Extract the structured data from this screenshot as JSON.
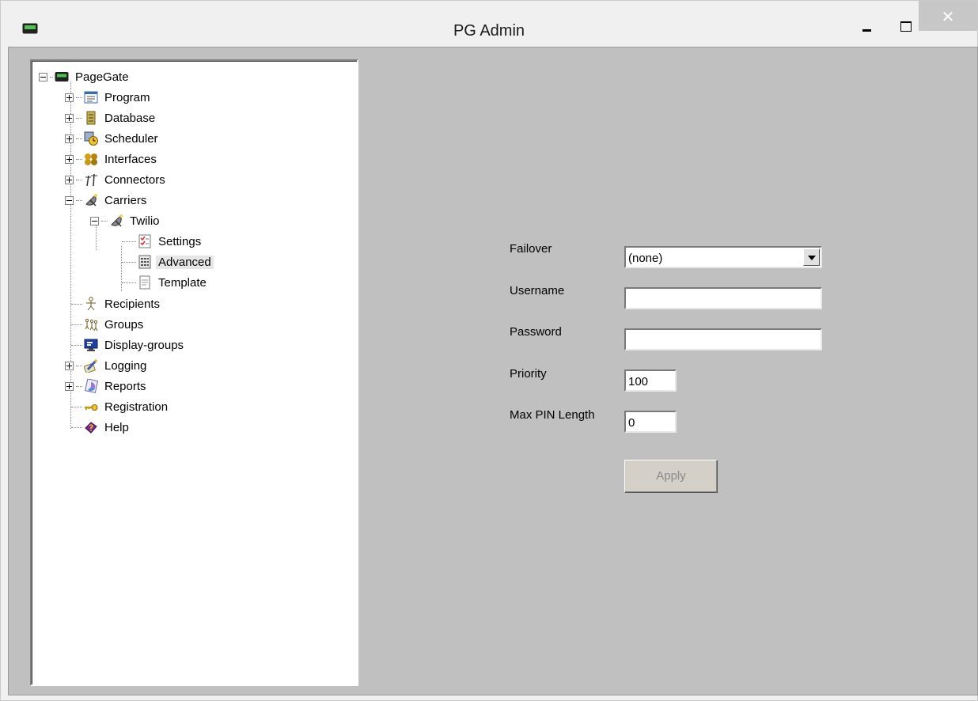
{
  "window": {
    "title": "PG Admin",
    "close_glyph": "✕"
  },
  "tree": {
    "root": "PageGate",
    "items": {
      "program": "Program",
      "database": "Database",
      "scheduler": "Scheduler",
      "interfaces": "Interfaces",
      "connectors": "Connectors",
      "carriers": "Carriers",
      "twilio": "Twilio",
      "settings": "Settings",
      "advanced": "Advanced",
      "template": "Template",
      "recipients": "Recipients",
      "groups": "Groups",
      "display_groups": "Display-groups",
      "logging": "Logging",
      "reports": "Reports",
      "registration": "Registration",
      "help": "Help"
    },
    "selected": "Advanced"
  },
  "form": {
    "failover_label": "Failover",
    "failover_value": "(none)",
    "username_label": "Username",
    "username_value": "",
    "password_label": "Password",
    "password_value": "",
    "priority_label": "Priority",
    "priority_value": "100",
    "max_pin_label": "Max PIN Length",
    "max_pin_value": "0",
    "apply_label": "Apply"
  },
  "colors": {
    "client_bg": "#c0c0c0",
    "tree_bg": "#ffffff",
    "close_button_bg": "#c7c7c7",
    "apply_disabled_text": "#8a8a8a"
  }
}
